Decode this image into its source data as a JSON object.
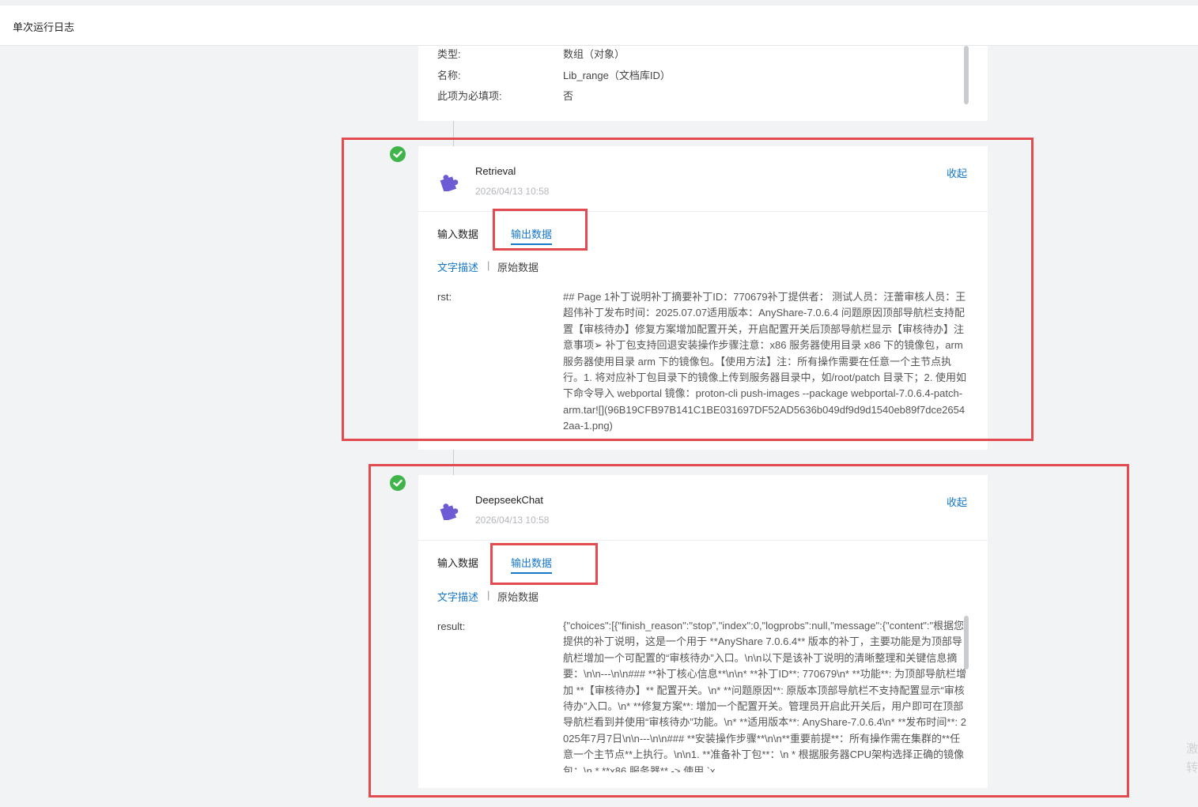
{
  "header": {
    "title": "单次运行日志"
  },
  "param_card": {
    "rows": [
      {
        "key": "类型:",
        "value": "数组（对象）"
      },
      {
        "key": "名称:",
        "value": "Lib_range（文档库ID）"
      },
      {
        "key": "此项为必填项:",
        "value": "否"
      }
    ]
  },
  "nodes": [
    {
      "title": "Retrieval",
      "time": "2026/04/13 10:58",
      "collapse_label": "收起",
      "tabs": {
        "input": "输入数据",
        "output": "输出数据"
      },
      "subtabs": {
        "desc": "文字描述",
        "sep": "|",
        "raw": "原始数据"
      },
      "field": {
        "label": "rst:",
        "value": "## Page 1补丁说明补丁摘要补丁ID：770679补丁提供者： 测试人员：汪蕾审核人员：王超伟补丁发布时间：2025.07.07适用版本：AnyShare-7.0.6.4 问题原因顶部导航栏支持配置【审核待办】修复方案增加配置开关，开启配置开关后顶部导航栏显示【审核待办】注意事项➢ 补丁包支持回退安装操作步骤注意：x86 服务器使用目录 x86 下的镜像包，arm 服务器使用目录 arm 下的镜像包。【使用方法】注：所有操作需要在任意一个主节点执行。1. 将对应补丁包目录下的镜像上传到服务器目录中，如/root/patch 目录下；2. 使用如下命令导入 webportal 镜像：proton-cli push-images --package webportal-7.0.6.4-patch-arm.tar![](96B19CFB97B141C1BE031697DF52AD5636b049df9d9d1540eb89f7dce26542aa-1.png)"
      }
    },
    {
      "title": "DeepseekChat",
      "time": "2026/04/13 10:58",
      "collapse_label": "收起",
      "tabs": {
        "input": "输入数据",
        "output": "输出数据"
      },
      "subtabs": {
        "desc": "文字描述",
        "sep": "|",
        "raw": "原始数据"
      },
      "field": {
        "label": "result:",
        "value": "{\"choices\":[{\"finish_reason\":\"stop\",\"index\":0,\"logprobs\":null,\"message\":{\"content\":\"根据您提供的补丁说明，这是一个用于 **AnyShare 7.0.6.4** 版本的补丁，主要功能是为顶部导航栏增加一个可配置的“审核待办”入口。\\n\\n以下是该补丁说明的清晰整理和关键信息摘要：\\n\\n---\\n\\n### **补丁核心信息**\\n\\n* **补丁ID**: 770679\\n* **功能**: 为顶部导航栏增加 **【审核待办】** 配置开关。\\n* **问题原因**: 原版本顶部导航栏不支持配置显示“审核待办”入口。\\n* **修复方案**: 增加一个配置开关。管理员开启此开关后，用户即可在顶部导航栏看到并使用“审核待办”功能。\\n* **适用版本**: AnyShare-7.0.6.4\\n* **发布时间**: 2025年7月7日\\n\\n---\\n\\n### **安装操作步骤**\\n\\n**重要前提**：所有操作需在集群的**任意一个主节点**上执行。\\n\\n1. **准备补丁包**：\\n * 根据服务器CPU架构选择正确的镜像包：\\n * **x86 服务器** -> 使用 `x"
      }
    }
  ],
  "side_text": [
    "激",
    "转"
  ]
}
